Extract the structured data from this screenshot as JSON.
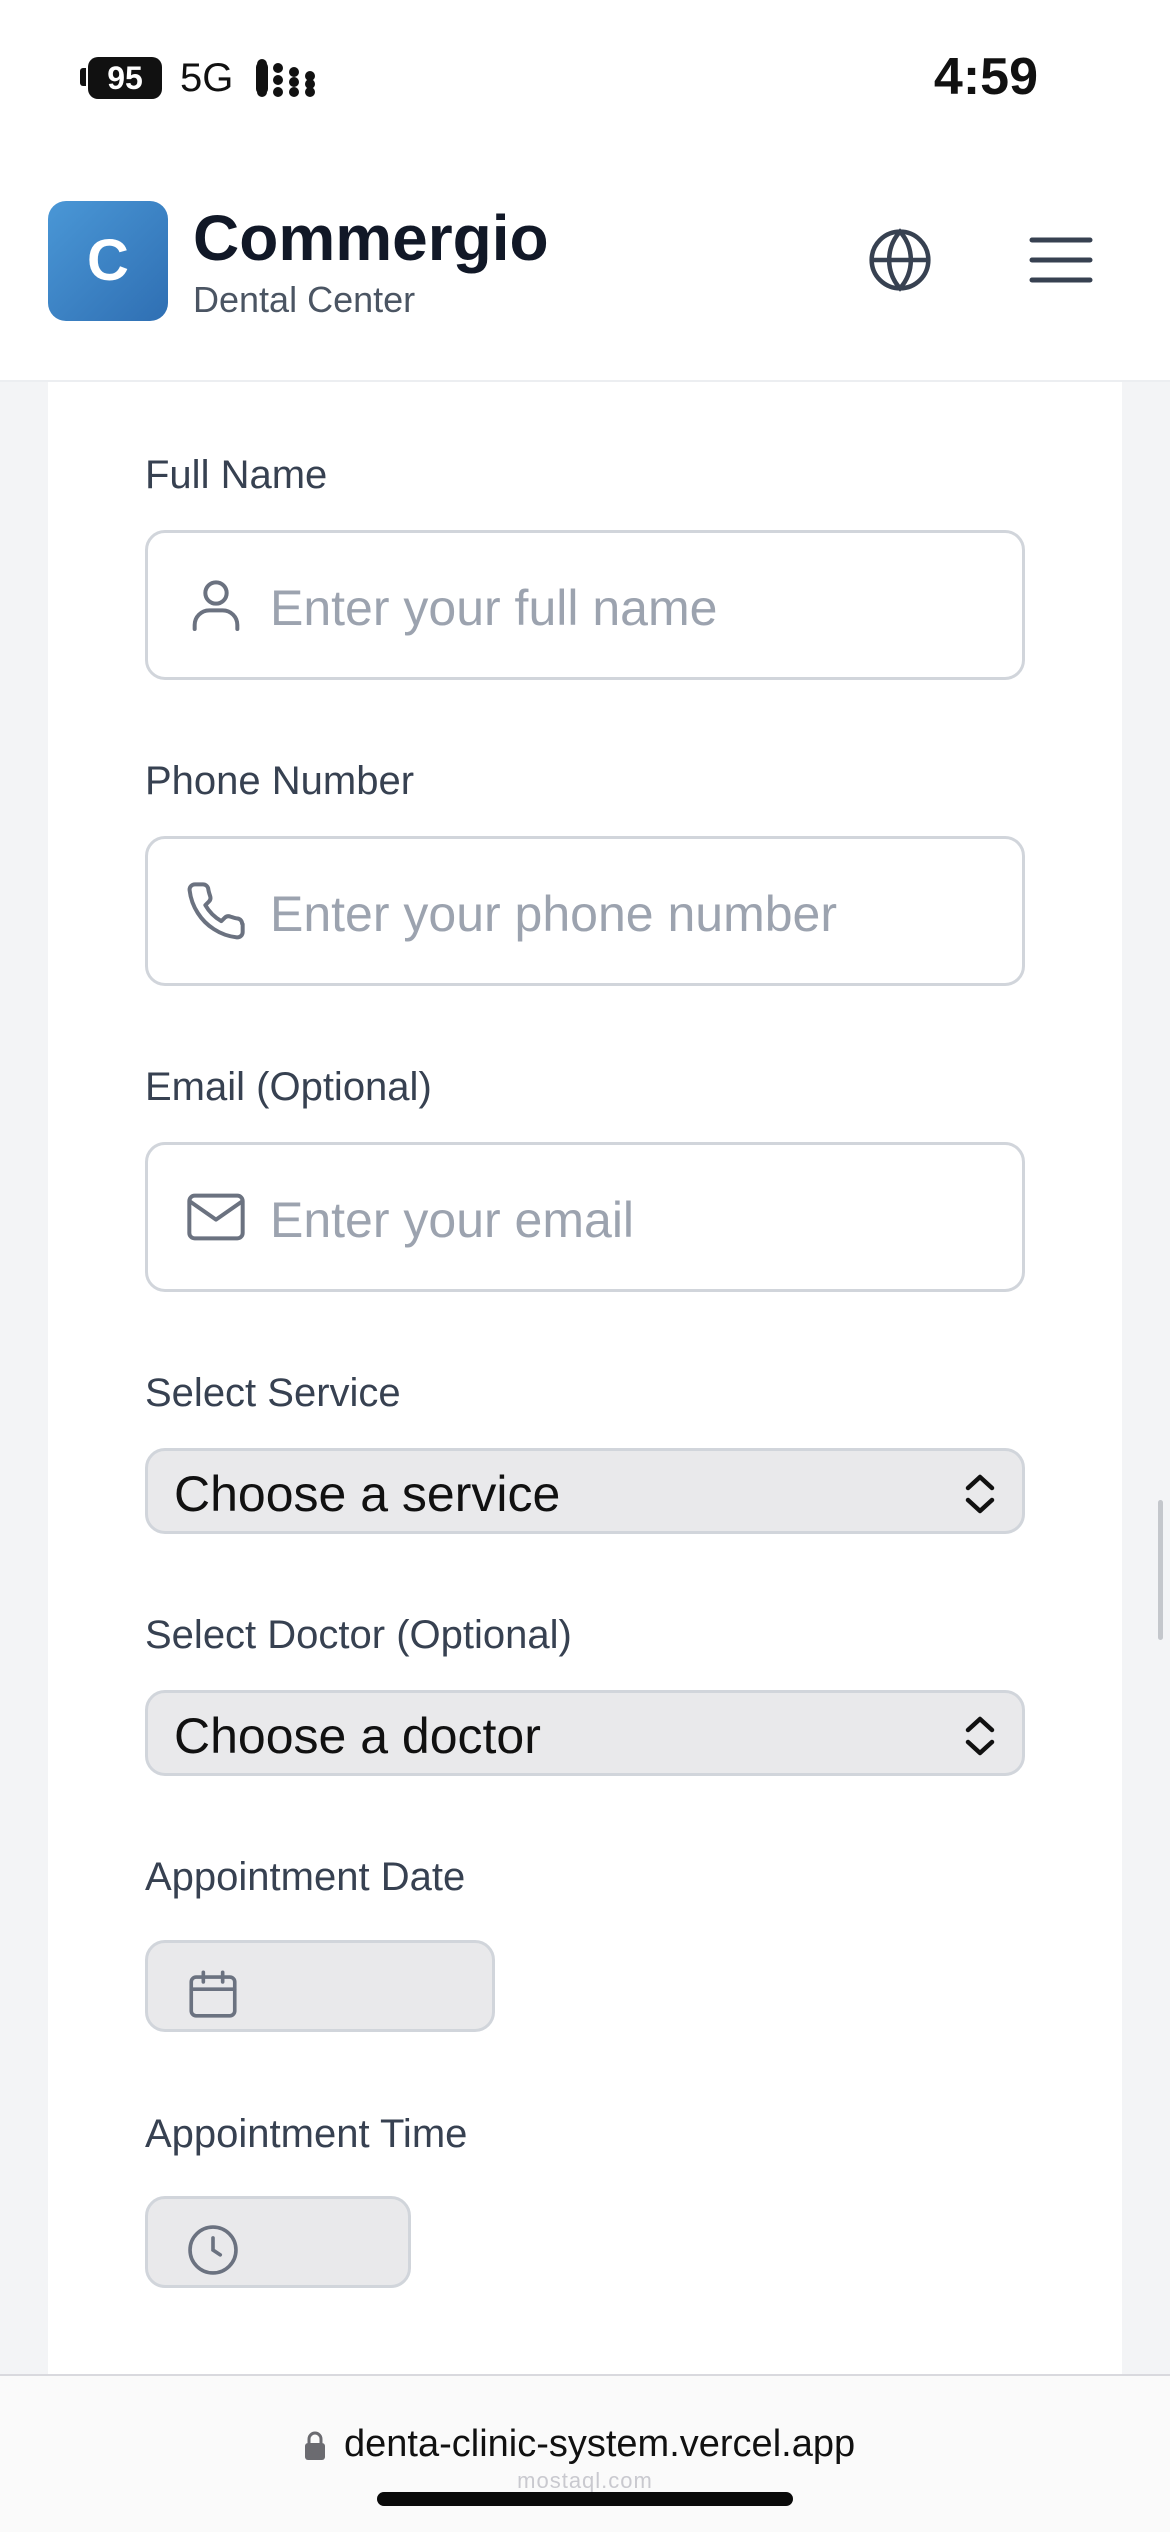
{
  "status_bar": {
    "battery": "95",
    "network": "5G",
    "time": "4:59"
  },
  "header": {
    "logo_letter": "C",
    "brand_name": "Commergio",
    "brand_subtitle": "Dental Center",
    "language_icon": "globe-icon",
    "menu_icon": "hamburger-menu-icon"
  },
  "form": {
    "full_name": {
      "label": "Full Name",
      "placeholder": "Enter your full name",
      "value": "",
      "icon": "user-icon"
    },
    "phone": {
      "label": "Phone Number",
      "placeholder": "Enter your phone number",
      "value": "",
      "icon": "phone-icon"
    },
    "email": {
      "label": "Email (Optional)",
      "placeholder": "Enter your email",
      "value": "",
      "icon": "mail-icon"
    },
    "service": {
      "label": "Select Service",
      "selected": "Choose a service"
    },
    "doctor": {
      "label": "Select Doctor (Optional)",
      "selected": "Choose a doctor"
    },
    "date": {
      "label": "Appointment Date",
      "value": "",
      "icon": "calendar-icon"
    },
    "time": {
      "label": "Appointment Time",
      "value": "",
      "icon": "clock-icon"
    }
  },
  "browser": {
    "url": "denta-clinic-system.vercel.app",
    "watermark": "mostaql.com"
  },
  "colors": {
    "brand_gradient_start": "#4a97d6",
    "brand_gradient_end": "#2f6fb3",
    "input_border": "#d1d5db",
    "placeholder": "#9ca3af"
  }
}
